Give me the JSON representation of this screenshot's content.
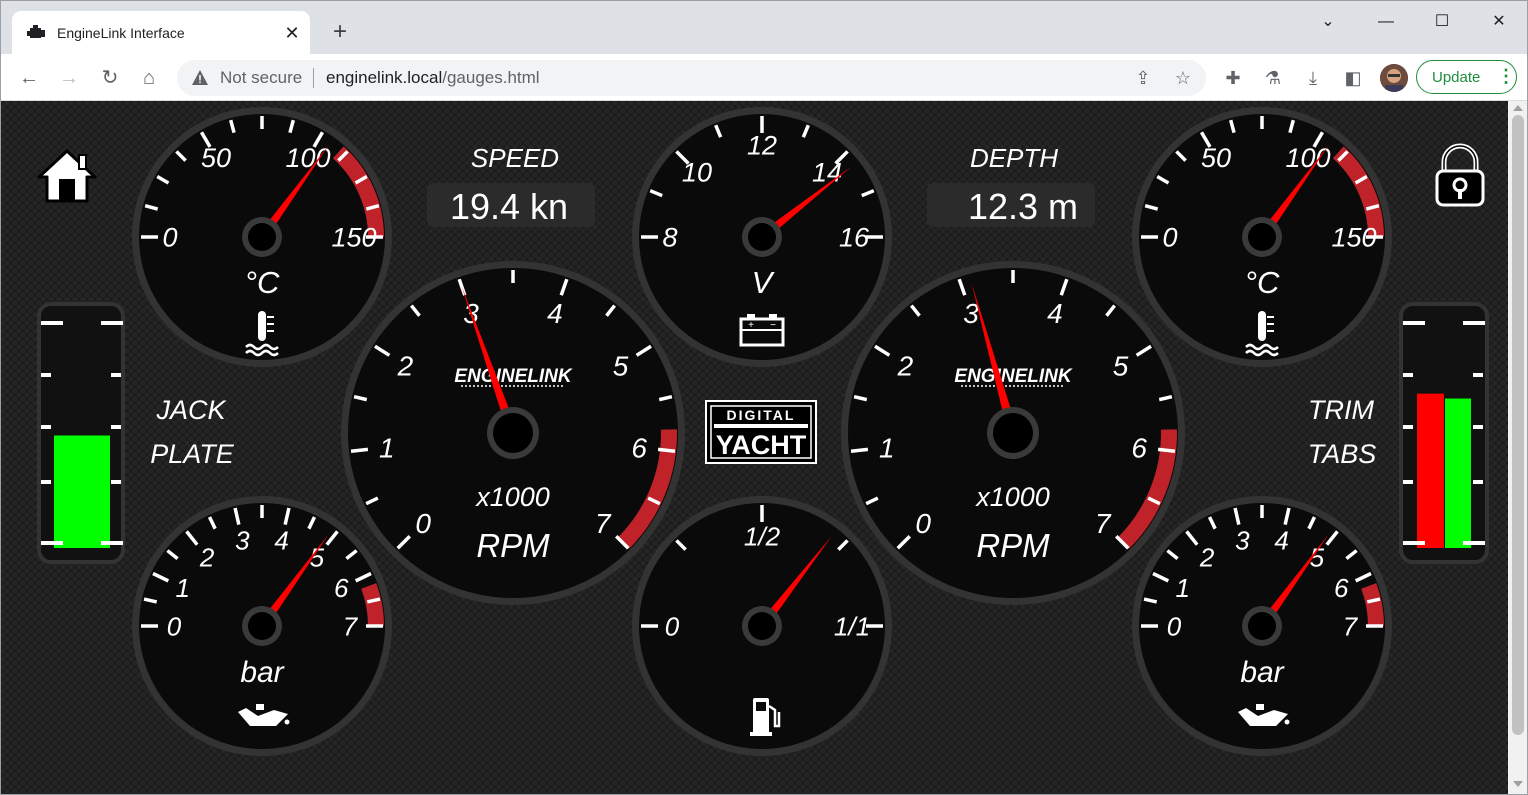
{
  "browser": {
    "tab_title": "EngineLink Interface",
    "address_status": "Not secure",
    "url_host": "enginelink.local",
    "url_path": "/gauges.html",
    "update_label": "Update"
  },
  "dashboard": {
    "speed": {
      "label": "SPEED",
      "value": "19.4 kn"
    },
    "depth": {
      "label": "DEPTH",
      "value": "12.3 m"
    },
    "jack_plate": {
      "label1": "JACK",
      "label2": "PLATE",
      "level": 0.5
    },
    "trim_tabs": {
      "label1": "TRIM",
      "label2": "TABS",
      "left_level": 0.63,
      "right_level": 0.61
    },
    "logo": {
      "line1": "DIGITAL",
      "line2": "YACHT"
    },
    "brand": "ENGINELINK",
    "colors": {
      "needle": "#ff0000",
      "redzone": "#c0222a",
      "bar_green": "#00ff00",
      "bar_red": "#ff0000"
    }
  },
  "gauges": [
    {
      "id": "temp-left",
      "unit": "°C",
      "icon": "coolant-temp-icon",
      "ticks": [
        "0",
        "50",
        "100",
        "150"
      ],
      "value": 105,
      "min": 0,
      "max": 150
    },
    {
      "id": "temp-right",
      "unit": "°C",
      "icon": "coolant-temp-icon",
      "ticks": [
        "0",
        "50",
        "100",
        "150"
      ],
      "value": 105,
      "min": 0,
      "max": 150
    },
    {
      "id": "voltage",
      "unit": "V",
      "icon": "battery-icon",
      "ticks": [
        "8",
        "10",
        "12",
        "14",
        "16"
      ],
      "value": 14.3,
      "min": 8,
      "max": 16
    },
    {
      "id": "rpm-left",
      "unit": "RPM",
      "multiplier": "x1000",
      "ticks": [
        "0",
        "1",
        "2",
        "3",
        "4",
        "5",
        "6",
        "7"
      ],
      "value": 3.0,
      "min": 0,
      "max": 7
    },
    {
      "id": "rpm-right",
      "unit": "RPM",
      "multiplier": "x1000",
      "ticks": [
        "0",
        "1",
        "2",
        "3",
        "4",
        "5",
        "6",
        "7"
      ],
      "value": 3.1,
      "min": 0,
      "max": 7
    },
    {
      "id": "oil-left",
      "unit": "bar",
      "icon": "oil-can-icon",
      "ticks": [
        "0",
        "1",
        "2",
        "3",
        "4",
        "5",
        "6",
        "7"
      ],
      "value": 4.9,
      "min": 0,
      "max": 7
    },
    {
      "id": "oil-right",
      "unit": "bar",
      "icon": "oil-can-icon",
      "ticks": [
        "0",
        "1",
        "2",
        "3",
        "4",
        "5",
        "6",
        "7"
      ],
      "value": 4.9,
      "min": 0,
      "max": 7
    },
    {
      "id": "fuel",
      "unit": "",
      "icon": "fuel-pump-icon",
      "ticks": [
        "0",
        "1/2",
        "1/1"
      ],
      "value": 0.71,
      "min": 0,
      "max": 1
    }
  ]
}
